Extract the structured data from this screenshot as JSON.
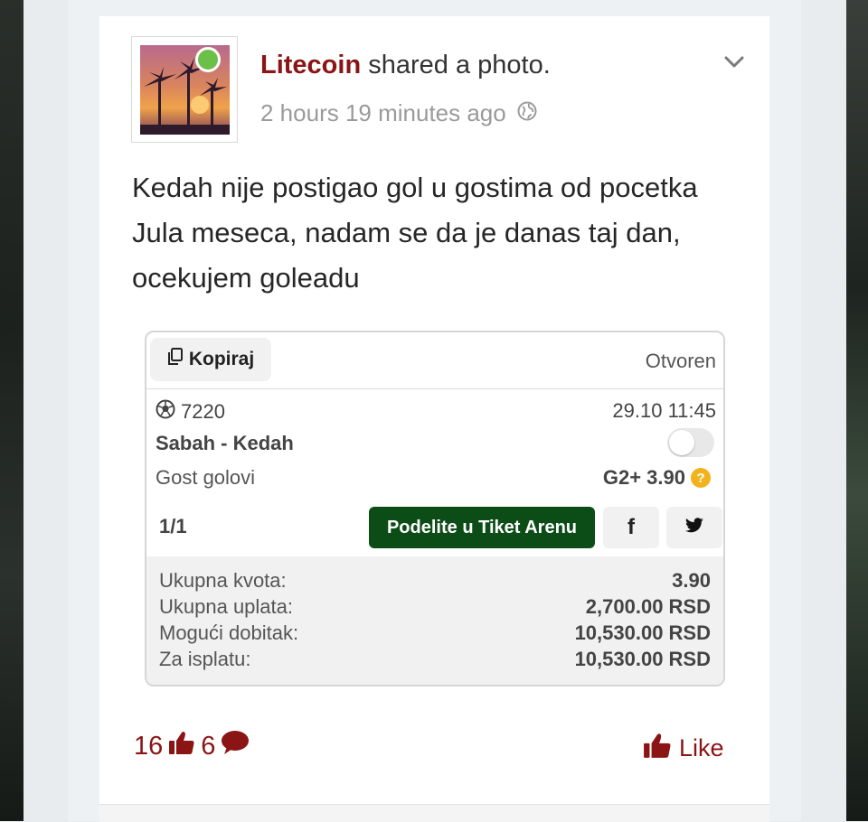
{
  "post": {
    "author": "Litecoin",
    "action": " shared a photo.",
    "time": "2 hours 19 minutes ago",
    "text": "Kedah nije postigao gol u gostima od pocetka Jula meseca, nadam se da je danas taj dan, ocekujem goleadu"
  },
  "ticket": {
    "copy_label": "Kopiraj",
    "status": "Otvoren",
    "event_id": "7220",
    "datetime": "29.10 11:45",
    "match": "Sabah - Kedah",
    "market": "Gost golovi",
    "pick": "G2+ 3.90",
    "count": "1/1",
    "share_label": "Podelite u Tiket Arenu",
    "facebook_label": "f",
    "summary": [
      {
        "label": "Ukupna kvota:",
        "value": "3.90"
      },
      {
        "label": "Ukupna uplata:",
        "value": "2,700.00 RSD"
      },
      {
        "label": "Mogući dobitak:",
        "value": "10,530.00 RSD"
      },
      {
        "label": "Za isplatu:",
        "value": "10,530.00 RSD"
      }
    ]
  },
  "footer": {
    "likes": "16",
    "comments": "6",
    "like_label": "Like"
  },
  "colors": {
    "accent": "#8b1414",
    "arena_button": "#0c4d17",
    "online": "#6cc04a",
    "help_icon": "#f2b21b"
  }
}
